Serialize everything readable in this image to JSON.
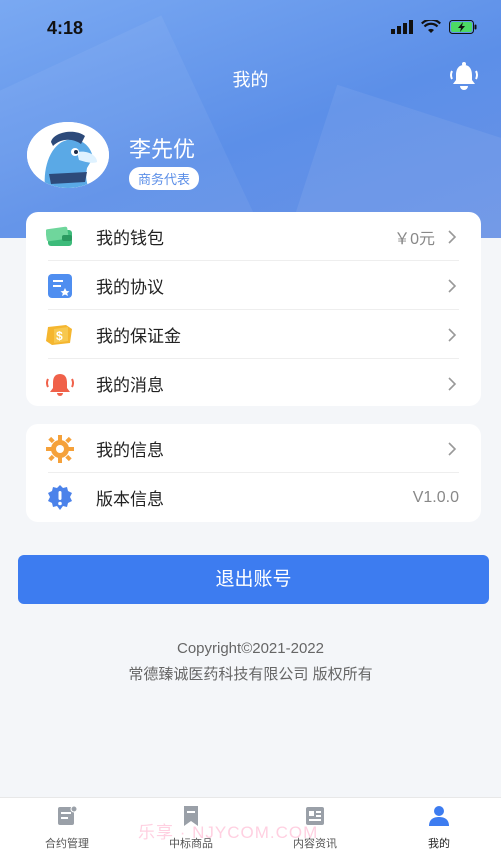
{
  "status_bar": {
    "time": "4:18"
  },
  "header": {
    "title": "我的"
  },
  "profile": {
    "name": "李先优",
    "role": "商务代表"
  },
  "menu_primary": [
    {
      "label": "我的钱包",
      "value": "￥0元",
      "icon": "wallet-icon"
    },
    {
      "label": "我的协议",
      "value": "",
      "icon": "agreement-icon"
    },
    {
      "label": "我的保证金",
      "value": "",
      "icon": "deposit-icon"
    },
    {
      "label": "我的消息",
      "value": "",
      "icon": "message-bell-icon"
    }
  ],
  "menu_secondary": [
    {
      "label": "我的信息",
      "value": "",
      "icon": "gear-info-icon"
    },
    {
      "label": "版本信息",
      "value": "V1.0.0",
      "icon": "version-icon"
    }
  ],
  "logout_label": "退出账号",
  "footer": {
    "copyright": "Copyright©2021-2022",
    "company": "常德臻诚医药科技有限公司  版权所有"
  },
  "tabbar": [
    {
      "label": "合约管理",
      "icon": "contract-icon",
      "active": false
    },
    {
      "label": "中标商品",
      "icon": "bookmark-icon",
      "active": false
    },
    {
      "label": "内容资讯",
      "icon": "news-icon",
      "active": false
    },
    {
      "label": "我的",
      "icon": "user-icon",
      "active": true
    }
  ],
  "watermark": "乐享 ·  NJYCOM.COM",
  "colors": {
    "primary": "#3d7cf0",
    "header": "#6a98ec",
    "inactive_tab": "#9aa0a8"
  }
}
